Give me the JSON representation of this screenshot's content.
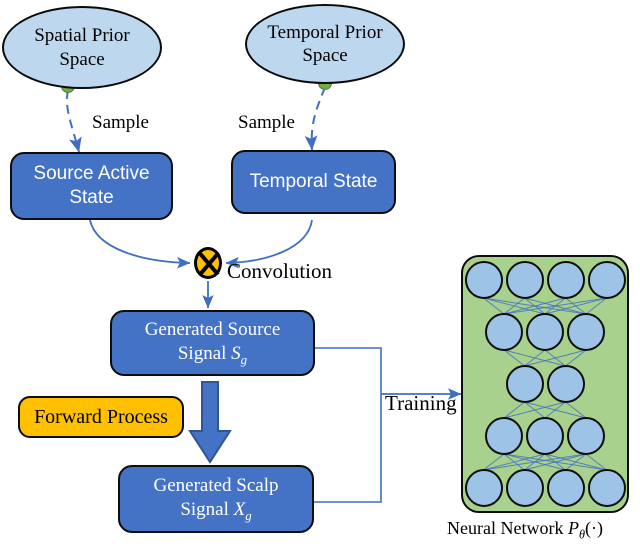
{
  "diagram": {
    "title": "Generative model training pipeline diagram",
    "colors": {
      "box_blue": "#4472C4",
      "ellipse_blue": "#BDD7EE",
      "gold": "#FFC000",
      "panel_green": "#A9D18E",
      "node_blue": "#9DC3E6",
      "arrow_blue": "#4472C4",
      "sample_dot_green": "#70AD47",
      "outline": "#0d0d0d"
    },
    "priors": [
      {
        "id": "spatial-prior-space",
        "line1": "Spatial Prior",
        "line2": "Space",
        "dot": "sample-origin-dot"
      },
      {
        "id": "temporal-prior-space",
        "line1": "Temporal Prior",
        "line2": "Space",
        "dot": "sample-origin-dot"
      }
    ],
    "sample_labels": [
      {
        "id": "sample-label-left",
        "text": "Sample"
      },
      {
        "id": "sample-label-right",
        "text": "Sample"
      }
    ],
    "states": [
      {
        "id": "source-active-state",
        "line1": "Source Active",
        "line2": "State"
      },
      {
        "id": "temporal-state",
        "line1": "Temporal State",
        "line2": ""
      }
    ],
    "convolution": {
      "id": "convolution-operator",
      "label": "Convolution",
      "glyph": "circled-times"
    },
    "signals": [
      {
        "id": "generated-source-signal",
        "line1": "Generated Source",
        "line2_prefix": "Signal ",
        "symbol": "S",
        "subscript": "g"
      },
      {
        "id": "generated-scalp-signal",
        "line1": "Generated Scalp",
        "line2_prefix": "Signal ",
        "symbol": "X",
        "subscript": "g"
      }
    ],
    "forward_process": {
      "id": "forward-process",
      "label": "Forward Process"
    },
    "training": {
      "id": "training-label",
      "label": "Training"
    },
    "neural_network": {
      "id": "neural-network-panel",
      "caption_prefix": "Neural Network ",
      "caption_symbol": "P",
      "caption_subscript": "θ",
      "caption_suffix": "(·)",
      "layers": [
        4,
        3,
        2,
        3,
        4
      ]
    }
  }
}
